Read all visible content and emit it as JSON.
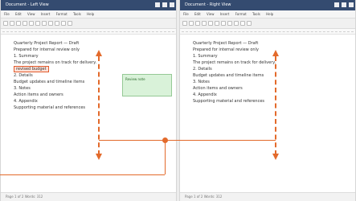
{
  "windows": {
    "left": {
      "title": "Document - Left View",
      "menu": [
        "File",
        "Edit",
        "View",
        "Insert",
        "Format",
        "Tools",
        "Help"
      ],
      "lines": [
        "Quarterly Project Report — Draft",
        "Prepared for internal review only",
        "",
        "1. Summary",
        "The project remains on track for delivery.",
        "2. Details",
        "Budget updates and timeline items",
        "3. Notes",
        "Action items and owners",
        "4. Appendix",
        "Supporting material and references"
      ],
      "highlight_text": "revised budget",
      "comment_text": "Review note",
      "status": "Page 1 of 2   Words: 312"
    },
    "right": {
      "title": "Document - Right View",
      "menu": [
        "File",
        "Edit",
        "View",
        "Insert",
        "Format",
        "Tools",
        "Help"
      ],
      "lines": [
        "Quarterly Project Report — Draft",
        "Prepared for internal review only",
        "",
        "1. Summary",
        "The project remains on track for delivery.",
        "2. Details",
        "Budget updates and timeline items",
        "3. Notes",
        "Action items and owners",
        "4. Appendix",
        "Supporting material and references"
      ],
      "status": "Page 1 of 2   Words: 312"
    }
  },
  "colors": {
    "accent": "#e36a2b",
    "titlebar": "#344b70",
    "comment_fill": "#d9f2d9"
  }
}
